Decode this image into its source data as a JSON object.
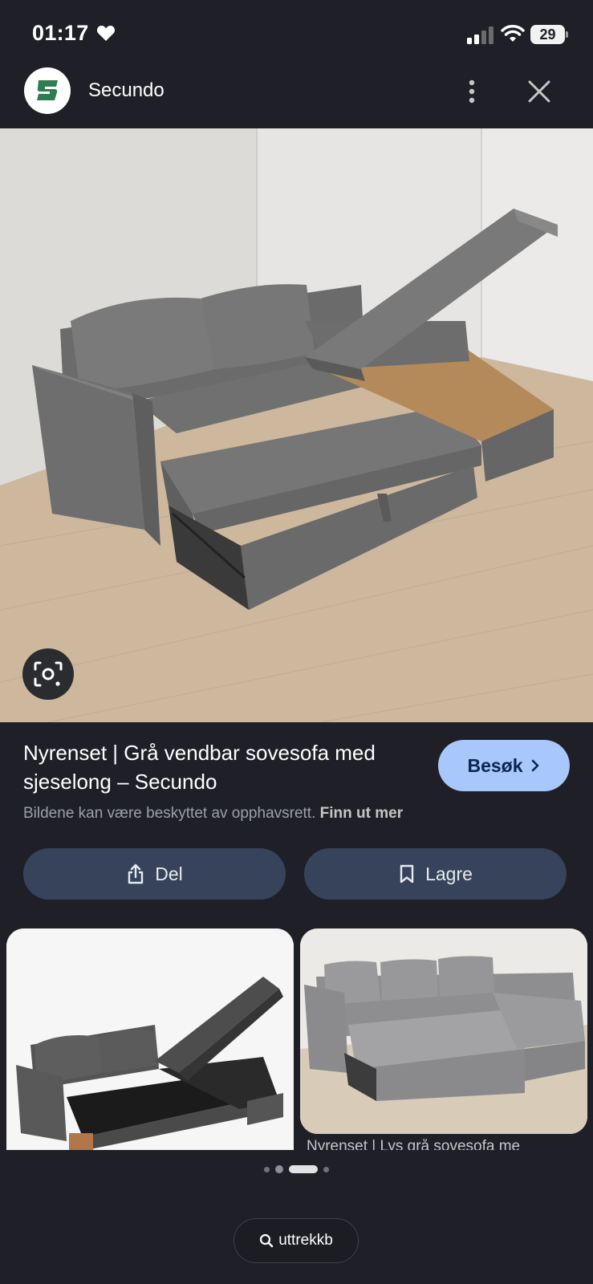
{
  "status_bar": {
    "time": "01:17",
    "battery": "29"
  },
  "header": {
    "site_logo_letter": "S",
    "site_name": "Secundo"
  },
  "result": {
    "title": "Nyrenset | Grå vendbar sovesofa med sjeselong – Secundo",
    "visit_label": "Besøk",
    "copyright": "Bildene kan være beskyttet av opphavsrett.",
    "learn_more": "Finn ut mer"
  },
  "actions": {
    "share_label": "Del",
    "save_label": "Lagre"
  },
  "related": {
    "second_caption": "Nyrenset | Lys grå sovesofa me"
  },
  "search": {
    "query": "uttrekkb"
  },
  "icons": {
    "status": [
      "heart-icon",
      "signal-icon",
      "wifi-icon",
      "battery-icon"
    ],
    "header": [
      "more-vertical-icon",
      "close-icon"
    ],
    "lens": "google-lens-icon",
    "visit": "chevron-right-icon",
    "share": "share-icon",
    "save": "bookmark-icon",
    "search": "search-icon"
  },
  "colors": {
    "background": "#1f2027",
    "visit_button": "#a8c7fa",
    "action_button": "#37435a",
    "logo_green": "#2e7d4f"
  },
  "pager": {
    "pages": 4,
    "active_index": 2
  }
}
